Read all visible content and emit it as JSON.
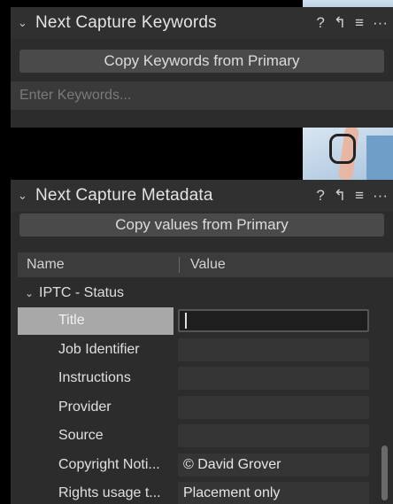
{
  "keywords_panel": {
    "title": "Next Capture Keywords",
    "copy_button": "Copy Keywords from Primary",
    "input_placeholder": "Enter Keywords..."
  },
  "metadata_panel": {
    "title": "Next Capture Metadata",
    "copy_button": "Copy values from Primary",
    "columns": {
      "name": "Name",
      "value": "Value"
    },
    "group": "IPTC - Status",
    "rows": [
      {
        "label": "Title",
        "value": ""
      },
      {
        "label": "Job Identifier",
        "value": ""
      },
      {
        "label": "Instructions",
        "value": ""
      },
      {
        "label": "Provider",
        "value": ""
      },
      {
        "label": "Source",
        "value": ""
      },
      {
        "label": "Copyright Noti...",
        "value": "© David Grover"
      },
      {
        "label": "Rights usage t...",
        "value": "Placement only"
      }
    ]
  },
  "header_tools": {
    "help": "?",
    "apply": "↰",
    "menu": "≡",
    "more": "···"
  },
  "icons": {
    "collapse": "⌄",
    "help": "question-icon",
    "apply": "apply-arrow-icon",
    "menu": "hamburger-icon",
    "more": "ellipsis-icon"
  },
  "colors": {
    "panel_bg": "#2c2c2c",
    "button_bg": "#4a4a4a",
    "selected_label_bg": "#a8a8a8"
  }
}
